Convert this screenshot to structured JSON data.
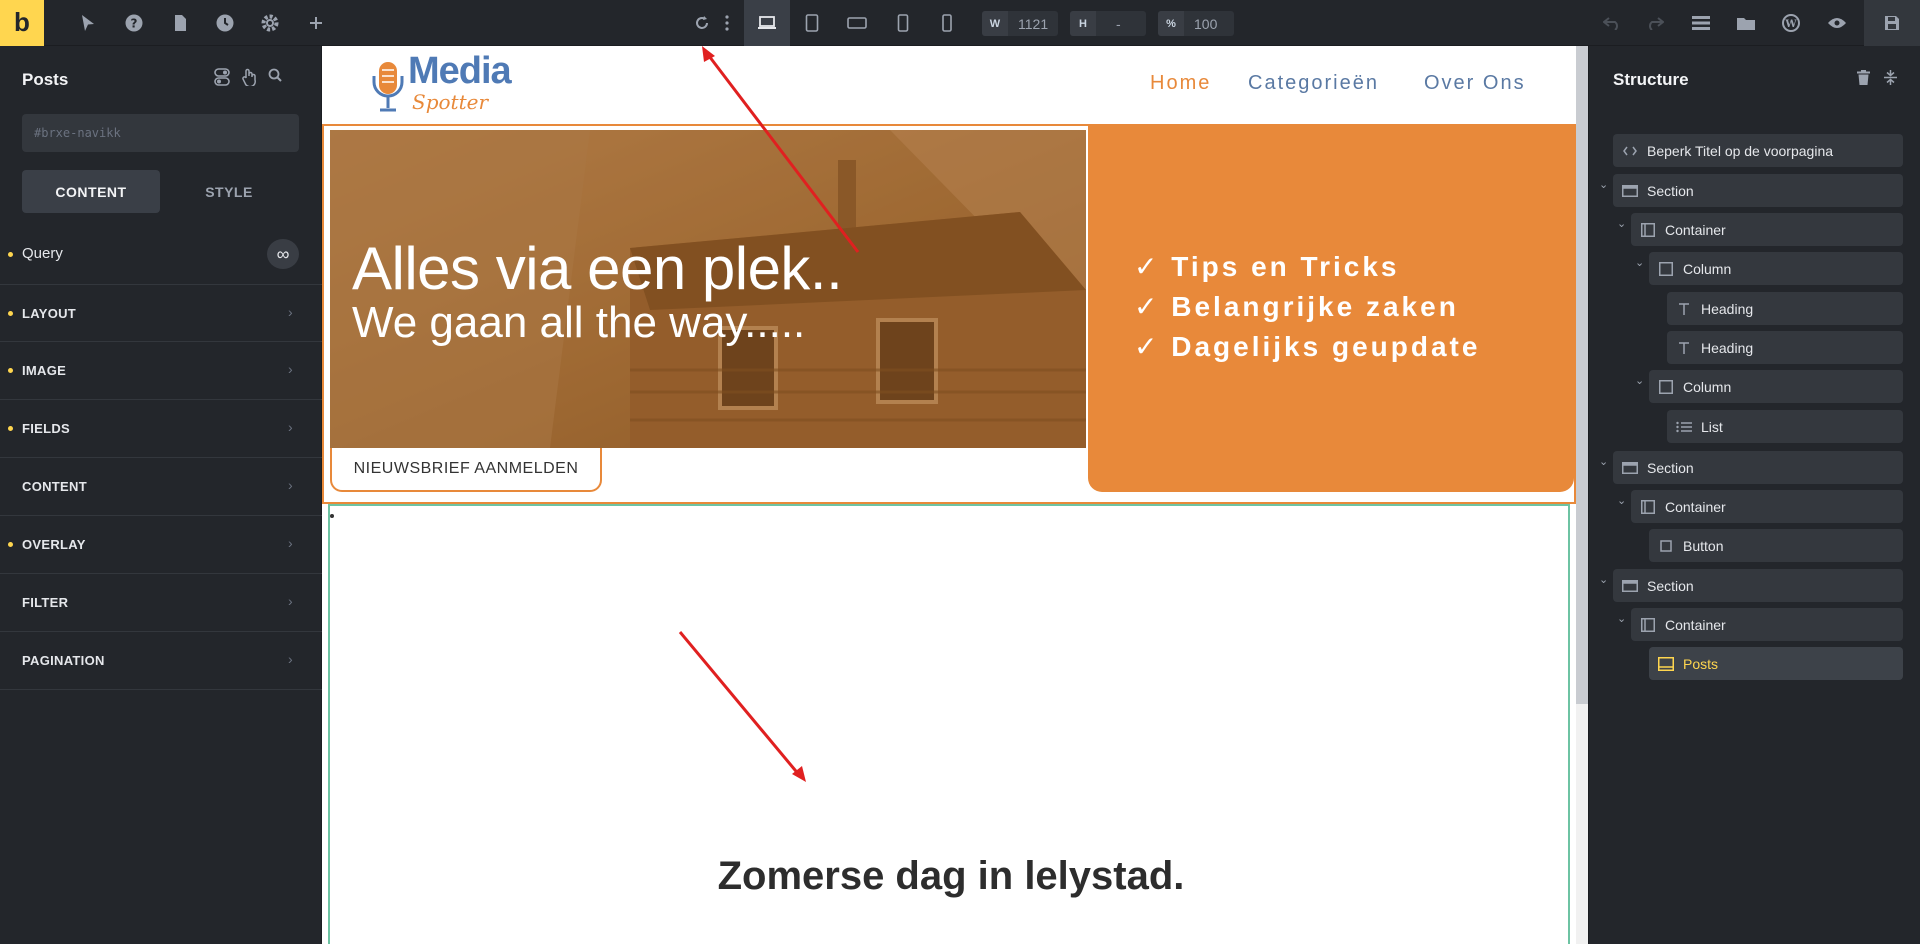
{
  "toolbar": {
    "logo": "b",
    "width_label": "W",
    "width_value": "1121",
    "height_label": "H",
    "height_value": "-",
    "zoom_label": "%",
    "zoom_value": "100",
    "icons": [
      "pointer-icon",
      "help-icon",
      "pages-icon",
      "history-icon",
      "settings-icon",
      "add-icon",
      "reload-icon",
      "more-icon",
      "desktop-icon",
      "tablet-portrait-icon",
      "tablet-landscape-icon",
      "mobile-landscape-icon",
      "mobile-portrait-icon",
      "undo-icon",
      "redo-icon",
      "structure-toggle-icon",
      "media-icon",
      "wordpress-icon",
      "preview-icon",
      "save-icon"
    ]
  },
  "left_panel": {
    "title": "Posts",
    "css_id_placeholder": "#brxe-navikk",
    "tabs": [
      "CONTENT",
      "STYLE"
    ],
    "query_label": "Query",
    "query_icon": "∞",
    "sections": [
      {
        "label": "LAYOUT",
        "dot": true
      },
      {
        "label": "IMAGE",
        "dot": true
      },
      {
        "label": "FIELDS",
        "dot": true
      },
      {
        "label": "CONTENT",
        "dot": false
      },
      {
        "label": "OVERLAY",
        "dot": true
      },
      {
        "label": "FILTER",
        "dot": false
      },
      {
        "label": "PAGINATION",
        "dot": false
      }
    ]
  },
  "site": {
    "brand_name": "Media",
    "brand_sub": "Spotter",
    "nav": [
      "Home",
      "Categorieën",
      "Over Ons"
    ],
    "hero_title": "Alles via een plek..",
    "hero_subtitle": "We gaan all the way.....",
    "list": [
      "✓ Tips en Tricks",
      "✓ Belangrijke zaken",
      "✓ Dagelijks geupdate"
    ],
    "newsletter_button": "NIEUWSBRIEF AANMELDEN",
    "post_title": "Zomerse dag in lelystad."
  },
  "structure": {
    "title": "Structure",
    "nodes": [
      {
        "label": "Beperk Titel op de voorpagina",
        "icon": "code-icon"
      },
      {
        "label": "Section",
        "icon": "section-icon"
      },
      {
        "label": "Container",
        "icon": "container-icon"
      },
      {
        "label": "Column",
        "icon": "column-icon"
      },
      {
        "label": "Heading",
        "icon": "heading-icon"
      },
      {
        "label": "Heading",
        "icon": "heading-icon"
      },
      {
        "label": "Column",
        "icon": "column-icon"
      },
      {
        "label": "List",
        "icon": "list-icon"
      },
      {
        "label": "Section",
        "icon": "section-icon"
      },
      {
        "label": "Container",
        "icon": "container-icon"
      },
      {
        "label": "Button",
        "icon": "button-icon"
      },
      {
        "label": "Section",
        "icon": "section-icon"
      },
      {
        "label": "Container",
        "icon": "container-icon"
      },
      {
        "label": "Posts",
        "icon": "posts-icon",
        "selected": true
      }
    ]
  },
  "colors": {
    "accent": "#ffd64f",
    "brand_orange": "#e8893a",
    "brand_blue": "#4f7ab5",
    "annotation_red": "#e02020",
    "selection_green": "#6ec3a3"
  }
}
